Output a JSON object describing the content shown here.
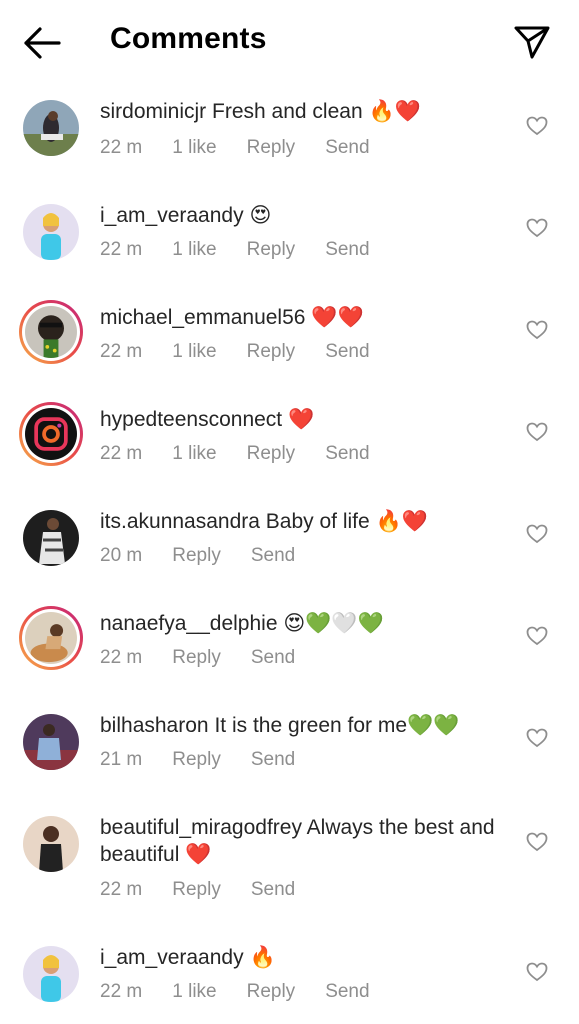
{
  "header": {
    "title": "Comments"
  },
  "comments": [
    {
      "username": "sirdominicjr",
      "text": "Fresh and clean",
      "emoji": "🔥❤️",
      "time": "22 m",
      "likes": "1 like",
      "reply": "Reply",
      "send": "Send"
    },
    {
      "username": "i_am_veraandy",
      "text": "",
      "emoji": "😍",
      "time": "22 m",
      "likes": "1 like",
      "reply": "Reply",
      "send": "Send"
    },
    {
      "username": "michael_emmanuel56",
      "text": "",
      "emoji": "❤️❤️",
      "time": "22 m",
      "likes": "1 like",
      "reply": "Reply",
      "send": "Send"
    },
    {
      "username": "hypedteensconnect",
      "text": "",
      "emoji": "❤️",
      "time": "22 m",
      "likes": "1 like",
      "reply": "Reply",
      "send": "Send"
    },
    {
      "username": "its.akunnasandra",
      "text": "Baby of life",
      "emoji": "🔥❤️",
      "time": "20 m",
      "reply": "Reply",
      "send": "Send"
    },
    {
      "username": "nanaefya__delphie",
      "text": "",
      "emoji": "😍💚🤍💚",
      "time": "22 m",
      "reply": "Reply",
      "send": "Send"
    },
    {
      "username": "bilhasharon",
      "text": "It is the green for me",
      "emoji": "💚💚",
      "time": "21 m",
      "reply": "Reply",
      "send": "Send"
    },
    {
      "username": "beautiful_miragodfrey",
      "text": "Always the best and beautiful",
      "emoji": "❤️",
      "time": "22 m",
      "reply": "Reply",
      "send": "Send"
    },
    {
      "username": "i_am_veraandy",
      "text": "",
      "emoji": "🔥",
      "time": "22 m",
      "likes": "1 like",
      "reply": "Reply",
      "send": "Send"
    }
  ],
  "icons": {
    "back": "back-arrow-icon",
    "send": "paper-plane-icon",
    "like": "heart-outline-icon"
  },
  "colors": {
    "text": "#262626",
    "secondary": "#8e8e8e",
    "heart_red": "#e8202d",
    "heart_green": "#3fc21e",
    "story_gradient_start": "#f7b14a",
    "story_gradient_end": "#c2237e"
  }
}
